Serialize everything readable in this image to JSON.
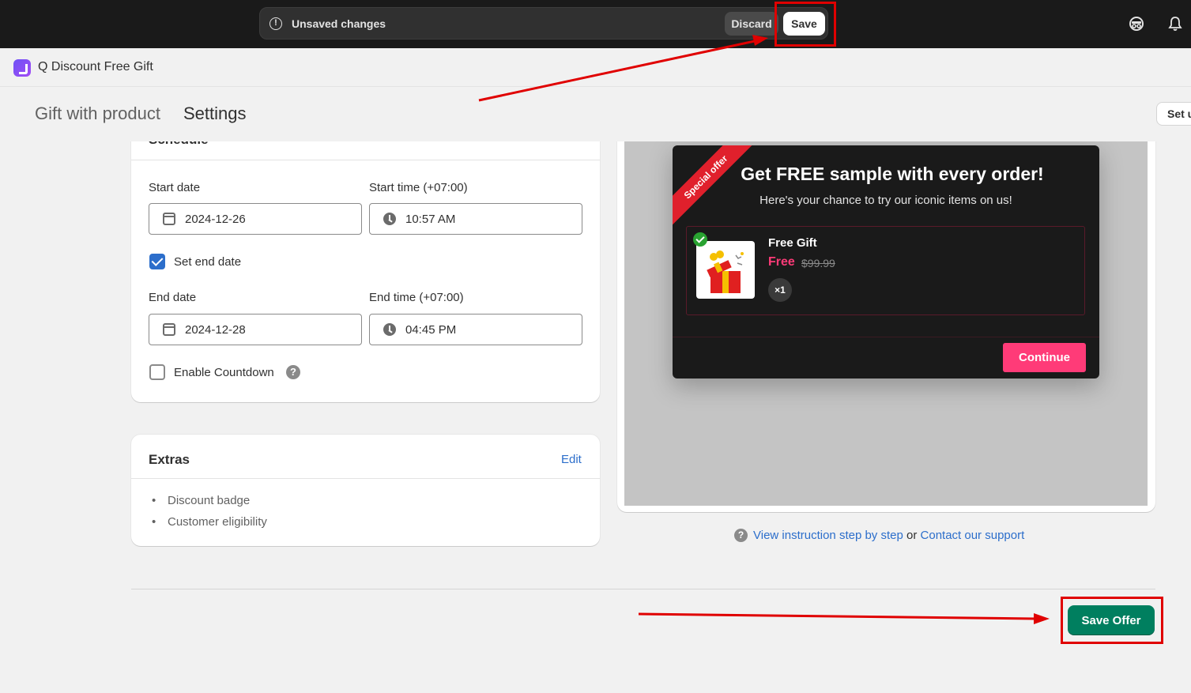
{
  "topbar": {
    "unsaved_message": "Unsaved changes",
    "discard_label": "Discard",
    "save_label": "Save"
  },
  "app": {
    "name": "Q Discount Free Gift"
  },
  "page": {
    "breadcrumb_parent": "Gift with product",
    "title": "Settings",
    "setup_button_label": "Set u"
  },
  "schedule": {
    "title": "Schedule",
    "start_date_label": "Start date",
    "start_date_value": "2024-12-26",
    "start_time_label": "Start time (+07:00)",
    "start_time_value": "10:57 AM",
    "set_end_date_label": "Set end date",
    "set_end_date_checked": true,
    "end_date_label": "End date",
    "end_date_value": "2024-12-28",
    "end_time_label": "End time (+07:00)",
    "end_time_value": "04:45 PM",
    "countdown_label": "Enable Countdown",
    "countdown_checked": false
  },
  "extras": {
    "title": "Extras",
    "edit_label": "Edit",
    "items": [
      "Discount badge",
      "Customer eligibility"
    ]
  },
  "preview": {
    "ribbon": "Special offer",
    "title": "Get FREE sample with every order!",
    "subtitle": "Here's your chance to try our iconic items on us!",
    "gift_name": "Free Gift",
    "gift_price": "Free",
    "gift_old_price": "$99.99",
    "gift_qty": "×1",
    "continue_label": "Continue"
  },
  "help": {
    "link1": "View instruction step by step",
    "separator": "or",
    "link2": "Contact our support"
  },
  "footer": {
    "save_offer_label": "Save Offer"
  },
  "colors": {
    "primary_button": "#007f5f",
    "popup_accent": "#ff3b78",
    "annotation": "#e00000",
    "link": "#2c6ecb"
  },
  "icons": [
    "alert-icon",
    "incognito-icon",
    "bell-icon",
    "calendar-icon",
    "clock-icon",
    "help-icon",
    "gift-image"
  ]
}
